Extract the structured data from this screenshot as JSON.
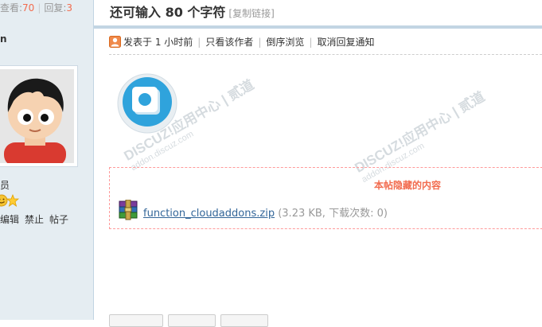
{
  "sidebar": {
    "stats": {
      "views_label": "查看:",
      "views_value": "70",
      "replies_label": "回复:",
      "replies_value": "3"
    },
    "username": "n",
    "group": "员",
    "actions": [
      "编辑",
      "禁止",
      "帖子"
    ]
  },
  "thread": {
    "title": "还可输入 80 个字符",
    "copy_link": "[复制链接]"
  },
  "post_meta": {
    "posted": "发表于 1 小时前",
    "only_author": "只看该作者",
    "reverse": "倒序浏览",
    "cancel_notify": "取消回复通知"
  },
  "hidden": {
    "title": "本帖隐藏的内容",
    "file_name": "function_cloudaddons.zip",
    "file_info": "(3.23 KB, 下载次数: 0)"
  },
  "watermark": {
    "brand": "DISCUZ!应用中心",
    "suffix": "贰道",
    "site": "addon.discuz.com"
  },
  "colors": {
    "accent": "#f26c4f",
    "link": "#336699",
    "sidebar_bg": "#e5edf2",
    "border": "#c2d5e3"
  }
}
